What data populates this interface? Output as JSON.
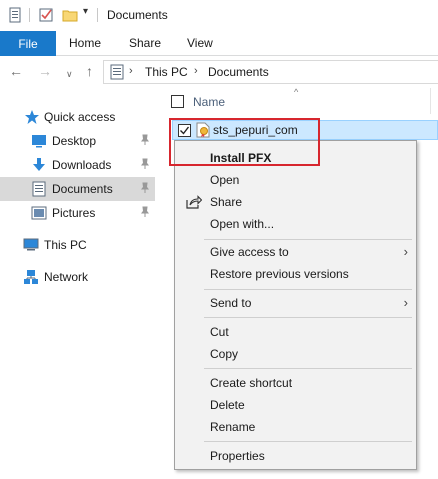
{
  "window": {
    "title": "Documents"
  },
  "ribbon": {
    "tabs": [
      "File",
      "Home",
      "Share",
      "View"
    ]
  },
  "address": {
    "crumbs": [
      "This PC",
      "Documents"
    ]
  },
  "navpane": {
    "items": [
      {
        "label": "Quick access",
        "icon": "star-icon"
      },
      {
        "label": "Desktop",
        "icon": "desktop-icon",
        "pinned": true
      },
      {
        "label": "Downloads",
        "icon": "download-icon",
        "pinned": true
      },
      {
        "label": "Documents",
        "icon": "documents-icon",
        "pinned": true,
        "selected": true
      },
      {
        "label": "Pictures",
        "icon": "pictures-icon",
        "pinned": true
      },
      {
        "label": "This PC",
        "icon": "computer-icon"
      },
      {
        "label": "Network",
        "icon": "network-icon"
      }
    ]
  },
  "content": {
    "column_name": "Name",
    "files": [
      {
        "name": "sts_pepuri_com",
        "selected": true,
        "checked": true
      }
    ]
  },
  "context_menu": {
    "items": [
      {
        "label": "Install PFX",
        "bold": true
      },
      {
        "label": "Open"
      },
      {
        "label": "Share",
        "icon": "share-icon"
      },
      {
        "label": "Open with..."
      },
      {
        "label": "Give access to",
        "submenu": true
      },
      {
        "label": "Restore previous versions"
      },
      {
        "label": "Send to",
        "submenu": true
      },
      {
        "label": "Cut"
      },
      {
        "label": "Copy"
      },
      {
        "label": "Create shortcut"
      },
      {
        "label": "Delete"
      },
      {
        "label": "Rename"
      },
      {
        "label": "Properties"
      }
    ]
  },
  "colors": {
    "accent": "#1979ca",
    "selection": "#cce8ff",
    "highlight_box": "#d7262e"
  }
}
